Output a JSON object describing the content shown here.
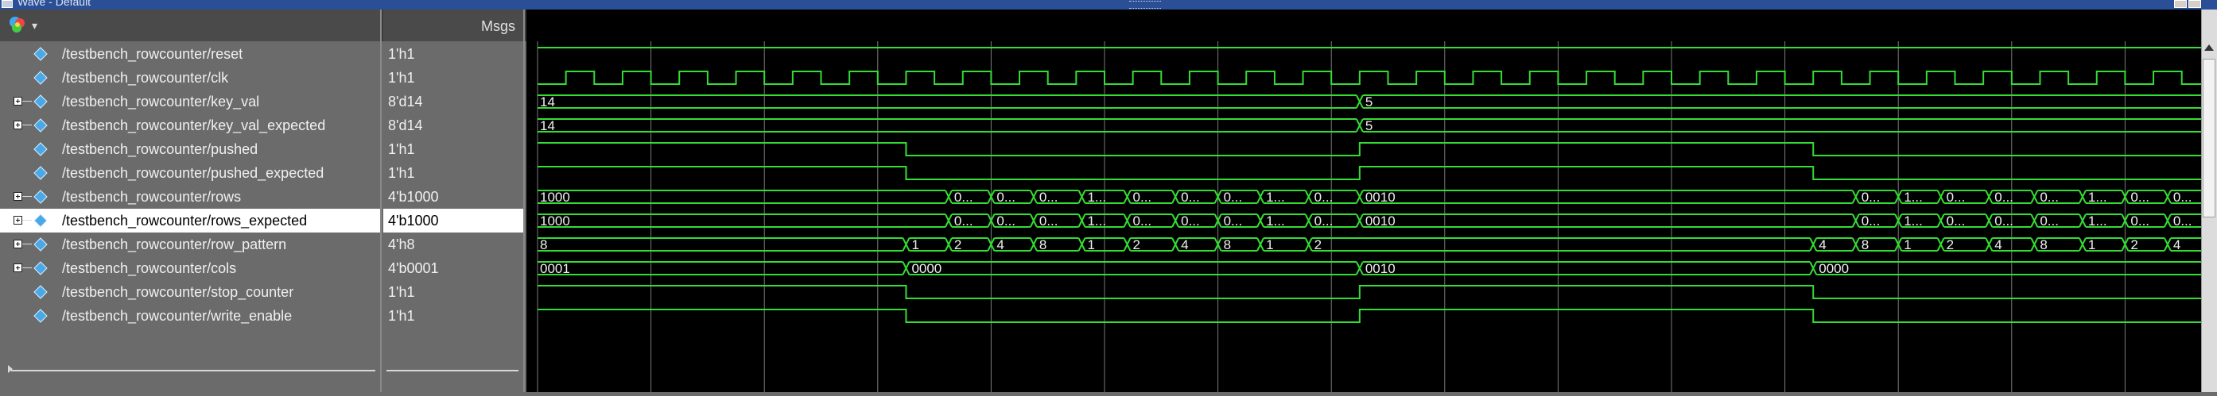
{
  "window": {
    "title": "Wave - Default"
  },
  "header": {
    "msgs_label": "Msgs"
  },
  "icons": {
    "palette": "color-palette-icon",
    "dropdown": "chevron-down-icon",
    "signal": "diamond-signal-icon",
    "expand": "expand-plus-icon"
  },
  "colors": {
    "wave": "#33dd33",
    "grid": "#7a7a7a",
    "text": "#f0f0f0",
    "diamond": "#4aa8e8"
  },
  "signals": [
    {
      "name": "/testbench_rowcounter/reset",
      "value": "1'h1",
      "bus": false,
      "selected": false,
      "wave": {
        "type": "bit",
        "start": 1,
        "edges": []
      }
    },
    {
      "name": "/testbench_rowcounter/clk",
      "value": "1'h1",
      "bus": false,
      "selected": false,
      "wave": {
        "type": "clock",
        "start": 0,
        "period": 1.0
      }
    },
    {
      "name": "/testbench_rowcounter/key_val",
      "value": "8'd14",
      "bus": true,
      "selected": false,
      "wave": {
        "type": "bus",
        "segments": [
          {
            "t": 0,
            "label": "14"
          },
          {
            "t": 14.5,
            "label": "5"
          }
        ]
      }
    },
    {
      "name": "/testbench_rowcounter/key_val_expected",
      "value": "8'd14",
      "bus": true,
      "selected": false,
      "wave": {
        "type": "bus",
        "segments": [
          {
            "t": 0,
            "label": "14"
          },
          {
            "t": 14.5,
            "label": "5"
          }
        ]
      }
    },
    {
      "name": "/testbench_rowcounter/pushed",
      "value": "1'h1",
      "bus": false,
      "selected": false,
      "wave": {
        "type": "bit",
        "start": 1,
        "edges": [
          6.5,
          14.5,
          22.5
        ]
      }
    },
    {
      "name": "/testbench_rowcounter/pushed_expected",
      "value": "1'h1",
      "bus": false,
      "selected": false,
      "wave": {
        "type": "bit",
        "start": 1,
        "edges": [
          6.5,
          14.5,
          22.5
        ]
      }
    },
    {
      "name": "/testbench_rowcounter/rows",
      "value": "4'b1000",
      "bus": true,
      "selected": false,
      "wave": {
        "type": "bus",
        "segments": [
          {
            "t": 0,
            "label": "1000"
          },
          {
            "t": 7.25,
            "label": "0..."
          },
          {
            "t": 8.0,
            "label": "0..."
          },
          {
            "t": 8.75,
            "label": "0..."
          },
          {
            "t": 9.6,
            "label": "1..."
          },
          {
            "t": 10.4,
            "label": "0..."
          },
          {
            "t": 11.25,
            "label": "0..."
          },
          {
            "t": 12.0,
            "label": "0..."
          },
          {
            "t": 12.75,
            "label": "1..."
          },
          {
            "t": 13.6,
            "label": "0..."
          },
          {
            "t": 14.5,
            "label": "0010"
          },
          {
            "t": 23.25,
            "label": "0..."
          },
          {
            "t": 24.0,
            "label": "1..."
          },
          {
            "t": 24.75,
            "label": "0..."
          },
          {
            "t": 25.6,
            "label": "0..."
          },
          {
            "t": 26.4,
            "label": "0..."
          },
          {
            "t": 27.25,
            "label": "1..."
          },
          {
            "t": 28.0,
            "label": "0..."
          },
          {
            "t": 28.75,
            "label": "0..."
          }
        ]
      }
    },
    {
      "name": "/testbench_rowcounter/rows_expected",
      "value": "4'b1000",
      "bus": true,
      "selected": true,
      "wave": {
        "type": "bus",
        "segments": [
          {
            "t": 0,
            "label": "1000"
          },
          {
            "t": 7.25,
            "label": "0..."
          },
          {
            "t": 8.0,
            "label": "0..."
          },
          {
            "t": 8.75,
            "label": "0..."
          },
          {
            "t": 9.6,
            "label": "1..."
          },
          {
            "t": 10.4,
            "label": "0..."
          },
          {
            "t": 11.25,
            "label": "0..."
          },
          {
            "t": 12.0,
            "label": "0..."
          },
          {
            "t": 12.75,
            "label": "1..."
          },
          {
            "t": 13.6,
            "label": "0..."
          },
          {
            "t": 14.5,
            "label": "0010"
          },
          {
            "t": 23.25,
            "label": "0..."
          },
          {
            "t": 24.0,
            "label": "1..."
          },
          {
            "t": 24.75,
            "label": "0..."
          },
          {
            "t": 25.6,
            "label": "0..."
          },
          {
            "t": 26.4,
            "label": "0..."
          },
          {
            "t": 27.25,
            "label": "1..."
          },
          {
            "t": 28.0,
            "label": "0..."
          },
          {
            "t": 28.75,
            "label": "0..."
          }
        ]
      }
    },
    {
      "name": "/testbench_rowcounter/row_pattern",
      "value": "4'h8",
      "bus": true,
      "selected": false,
      "wave": {
        "type": "bus",
        "segments": [
          {
            "t": 0,
            "label": "8"
          },
          {
            "t": 6.5,
            "label": "1"
          },
          {
            "t": 7.25,
            "label": "2"
          },
          {
            "t": 8.0,
            "label": "4"
          },
          {
            "t": 8.75,
            "label": "8"
          },
          {
            "t": 9.6,
            "label": "1"
          },
          {
            "t": 10.4,
            "label": "2"
          },
          {
            "t": 11.25,
            "label": "4"
          },
          {
            "t": 12.0,
            "label": "8"
          },
          {
            "t": 12.75,
            "label": "1"
          },
          {
            "t": 13.6,
            "label": "2"
          },
          {
            "t": 22.5,
            "label": "4"
          },
          {
            "t": 23.25,
            "label": "8"
          },
          {
            "t": 24.0,
            "label": "1"
          },
          {
            "t": 24.75,
            "label": "2"
          },
          {
            "t": 25.6,
            "label": "4"
          },
          {
            "t": 26.4,
            "label": "8"
          },
          {
            "t": 27.25,
            "label": "1"
          },
          {
            "t": 28.0,
            "label": "2"
          },
          {
            "t": 28.75,
            "label": "4"
          }
        ]
      }
    },
    {
      "name": "/testbench_rowcounter/cols",
      "value": "4'b0001",
      "bus": true,
      "selected": false,
      "wave": {
        "type": "bus",
        "segments": [
          {
            "t": 0,
            "label": "0001"
          },
          {
            "t": 6.5,
            "label": "0000"
          },
          {
            "t": 14.5,
            "label": "0010"
          },
          {
            "t": 22.5,
            "label": "0000"
          }
        ]
      }
    },
    {
      "name": "/testbench_rowcounter/stop_counter",
      "value": "1'h1",
      "bus": false,
      "selected": false,
      "wave": {
        "type": "bit",
        "start": 1,
        "edges": [
          6.5,
          14.5,
          22.5
        ]
      }
    },
    {
      "name": "/testbench_rowcounter/write_enable",
      "value": "1'h1",
      "bus": false,
      "selected": false,
      "wave": {
        "type": "bit",
        "start": 1,
        "edges": [
          6.5,
          14.5,
          22.5
        ]
      }
    }
  ]
}
